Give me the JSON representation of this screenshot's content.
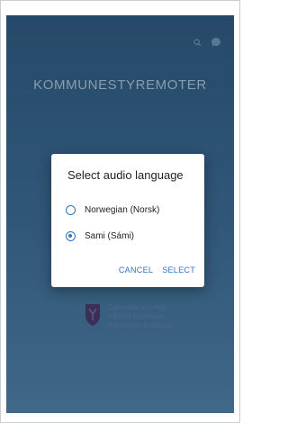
{
  "app": {
    "title": "KOMMUNESTYREMOTER",
    "logo_lines": [
      "Gáivuona suohkan",
      "Kåfjord kommune",
      "Kaivuonon komuuni"
    ]
  },
  "toolbar": {
    "icons": [
      "search-icon",
      "chat-icon"
    ]
  },
  "dialog": {
    "title": "Select audio language",
    "options": [
      {
        "label": "Norwegian (Norsk)",
        "selected": false
      },
      {
        "label": "Sami (Sámi)",
        "selected": true
      }
    ],
    "cancel_label": "CANCEL",
    "select_label": "SELECT"
  },
  "colors": {
    "accent": "#2e75c4",
    "background_top": "#2f5a80",
    "background_bottom": "#4f7fa6"
  }
}
